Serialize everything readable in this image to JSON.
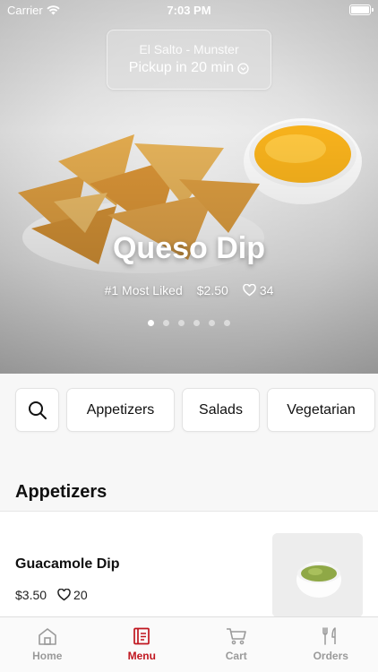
{
  "status_bar": {
    "carrier": "Carrier",
    "time": "7:03 PM"
  },
  "hero": {
    "location": "El Salto - Munster",
    "pickup": "Pickup in 20 min",
    "title": "Queso Dip",
    "tag": "#1 Most Liked",
    "price": "$2.50",
    "likes": "34",
    "slide_count": 6,
    "active_slide": 0
  },
  "categories": [
    {
      "label": "Appetizers"
    },
    {
      "label": "Salads"
    },
    {
      "label": "Vegetarian"
    }
  ],
  "section": {
    "title": "Appetizers"
  },
  "items": [
    {
      "name": "Guacamole Dip",
      "price": "$3.50",
      "likes": "20"
    }
  ],
  "tabs": [
    {
      "label": "Home",
      "icon": "home-icon"
    },
    {
      "label": "Menu",
      "icon": "menu-icon",
      "active": true
    },
    {
      "label": "Cart",
      "icon": "cart-icon"
    },
    {
      "label": "Orders",
      "icon": "orders-icon"
    }
  ],
  "colors": {
    "accent": "#c0161f",
    "inactive": "#9a9a9a"
  }
}
